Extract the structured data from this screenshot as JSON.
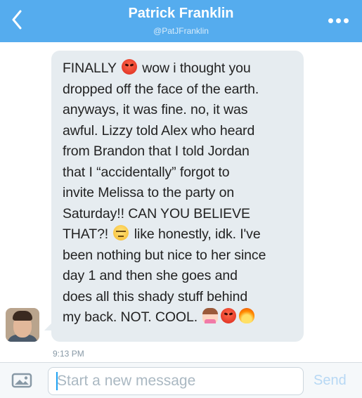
{
  "header": {
    "title": "Patrick Franklin",
    "handle": "@PatJFranklin",
    "back_icon": "chevron-left-icon",
    "more_icon": "more-dots-icon",
    "background": "#55acee"
  },
  "message": {
    "lines": [
      "FINALLY",
      " wow i thought you",
      "dropped off the face of the earth.",
      "anyways, it was fine. no, it was",
      "awful. Lizzy told Alex who heard",
      "from Brandon that I told Jordan",
      "that I “accidentally” forgot to",
      "invite Melissa to the party on",
      "Saturday!! CAN YOU BELIEVE",
      "THAT?!",
      " like honestly, idk. I've",
      "been nothing but nice to her since",
      "day 1 and then she goes and",
      "does all this shady stuff behind",
      "my back. NOT. COOL."
    ],
    "emojis": [
      "angry-face",
      "unamused-face",
      "woman-gesturing-no",
      "angry-face",
      "fire"
    ],
    "time": "9:13 PM",
    "bubble_color": "#e6ecf0"
  },
  "composer": {
    "photo_icon": "photo-icon",
    "placeholder": "Start a new message",
    "value": "",
    "send_label": "Send"
  }
}
